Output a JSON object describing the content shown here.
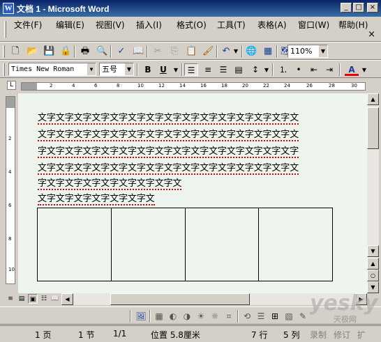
{
  "window": {
    "title": "文档 1 - Microsoft Word",
    "icon_letter": "W",
    "buttons": {
      "minimize": "_",
      "maximize": "□",
      "close": "×"
    }
  },
  "menu": {
    "items": [
      {
        "label": "文件(F)"
      },
      {
        "label": "编辑(E)"
      },
      {
        "label": "视图(V)"
      },
      {
        "label": "插入(I)"
      },
      {
        "label": "格式(O)"
      },
      {
        "label": "工具(T)"
      },
      {
        "label": "表格(A)"
      },
      {
        "label": "窗口(W)"
      },
      {
        "label": "帮助(H)"
      }
    ],
    "doc_close": "×"
  },
  "standard_toolbar": {
    "zoom": "110%"
  },
  "format_toolbar": {
    "font": "Times New Roman",
    "size": "五号",
    "bold": "B",
    "underline": "U",
    "font_color_letter": "A"
  },
  "ruler": {
    "h_ticks": [
      "2",
      "4",
      "6",
      "8",
      "10",
      "12",
      "14",
      "16",
      "18",
      "20",
      "22",
      "24",
      "26",
      "28",
      "30"
    ],
    "v_ticks": [
      "2",
      "4",
      "6",
      "8",
      "10"
    ]
  },
  "document": {
    "lines": [
      "文字文字文字文字文字文字文字文字文字文字文字文字文字文字文",
      "文字文字文字文字文字文字文字文字文字文字文字文字文字文字文",
      "字文字文字文字文字文字文字文字文字文字文字文字文字文字文字",
      "文字文字文字文字文字文字文字文字文字文字文字文字文字文字文",
      "字文字文字文字文字文字文字文字文",
      "文字文字文字文字文字文字文"
    ],
    "table": {
      "rows": 1,
      "cols": 4
    }
  },
  "status": {
    "page": "1 页",
    "section": "1 节",
    "pages": "1/1",
    "position": "位置 5.8厘米",
    "line": "7 行",
    "column": "5 列",
    "record": "录制",
    "revision": "修订",
    "extend": "扩"
  },
  "watermark": {
    "brand": "yesky",
    "sub": "天极网"
  }
}
